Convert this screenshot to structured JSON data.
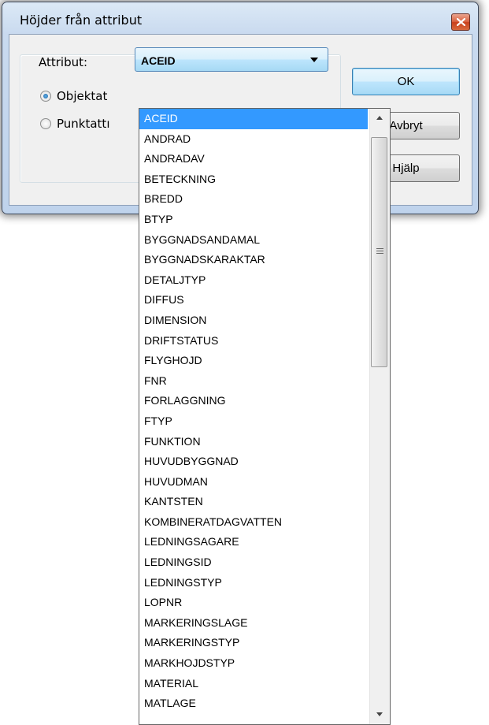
{
  "window": {
    "title": "Höjder från attribut"
  },
  "form": {
    "attribute_label": "Attribut:",
    "attribute_selected": "ACEID",
    "radio_object": "Objektat",
    "radio_point": "Punktattı",
    "radio_checked": "object"
  },
  "buttons": {
    "ok": "OK",
    "cancel": "Avbryt",
    "help": "Hjälp"
  },
  "dropdown": {
    "selected_index": 0,
    "items": [
      "ACEID",
      "ANDRAD",
      "ANDRADAV",
      "BETECKNING",
      "BREDD",
      "BTYP",
      "BYGGNADSANDAMAL",
      "BYGGNADSKARAKTAR",
      "DETALJTYP",
      "DIFFUS",
      "DIMENSION",
      "DRIFTSTATUS",
      "FLYGHOJD",
      "FNR",
      "FORLAGGNING",
      "FTYP",
      "FUNKTION",
      "HUVUDBYGGNAD",
      "HUVUDMAN",
      "KANTSTEN",
      "KOMBINERATDAGVATTEN",
      "LEDNINGSAGARE",
      "LEDNINGSID",
      "LEDNINGSTYP",
      "LOPNR",
      "MARKERINGSLAGE",
      "MARKERINGSTYP",
      "MARKHOJDSTYP",
      "MATERIAL",
      "MATLAGE"
    ]
  }
}
